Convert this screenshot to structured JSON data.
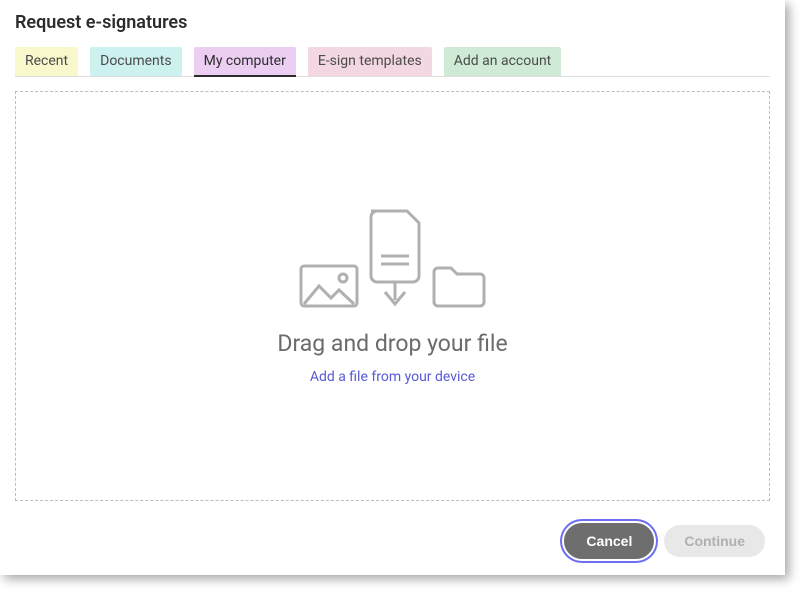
{
  "title": "Request e-signatures",
  "tabs": {
    "recent": "Recent",
    "documents": "Documents",
    "my_computer": "My computer",
    "esign_templates": "E-sign templates",
    "add_account": "Add an account"
  },
  "dropzone": {
    "heading": "Drag and drop your file",
    "link": "Add a file from your device"
  },
  "footer": {
    "cancel": "Cancel",
    "continue": "Continue"
  }
}
